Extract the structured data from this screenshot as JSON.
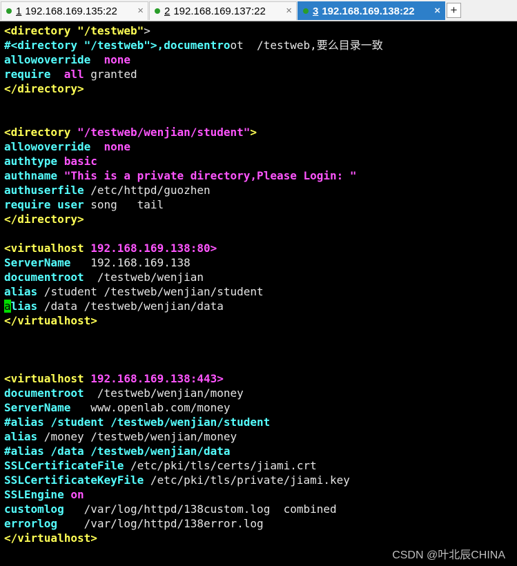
{
  "tabs": [
    {
      "number": "1",
      "label": "192.168.169.135:22",
      "status_color": "#2a9d2a",
      "close": "×",
      "active": false
    },
    {
      "number": "2",
      "label": "192.168.169.137:22",
      "status_color": "#2a9d2a",
      "close": "×",
      "active": false
    },
    {
      "number": "3",
      "label": "192.168.169.138:22",
      "status_color": "#2a9d2a",
      "close": "×",
      "active": true
    }
  ],
  "new_tab_label": "+",
  "terminal": {
    "lines": [
      "<directory \"/testweb\">",
      "#<directory \"/testweb\">,documentroot  /testweb,要么目录一致",
      "allowoverride  none",
      "require  all granted",
      "</directory>",
      "",
      "",
      "<directory \"/testweb/wenjian/student\">",
      "allowoverride  none",
      "authtype basic",
      "authname \"This is a private directory,Please Login: \"",
      "authuserfile /etc/httpd/guozhen",
      "require user song   tail",
      "</directory>",
      "",
      "<virtualhost 192.168.169.138:80>",
      "ServerName   192.168.169.138",
      "documentroot  /testweb/wenjian",
      "alias /student /testweb/wenjian/student",
      "alias /data /testweb/wenjian/data",
      "</virtualhost>",
      "",
      "",
      "",
      "<virtualhost 192.168.169.138:443>",
      "documentroot  /testweb/wenjian/money",
      "ServerName   www.openlab.com/money",
      "#alias /student /testweb/wenjian/student",
      "alias /money /testweb/wenjian/money",
      "#alias /data /testweb/wenjian/data",
      "SSLCertificateFile /etc/pki/tls/certs/jiami.crt",
      "SSLCertificateKeyFile /etc/pki/tls/private/jiami.key",
      "SSLEngine on",
      "customlog   /var/log/httpd/138custom.log  combined",
      "errorlog    /var/log/httpd/138error.log",
      "</virtualhost>"
    ]
  },
  "colors": {
    "tag": "#ffff55",
    "directive": "#55ffff",
    "value": "#ff55ff",
    "plain": "#e5e5e5",
    "cursor": "#00dd00",
    "active_tab": "#2d7fc9"
  },
  "watermark": "CSDN @叶北辰CHINA"
}
